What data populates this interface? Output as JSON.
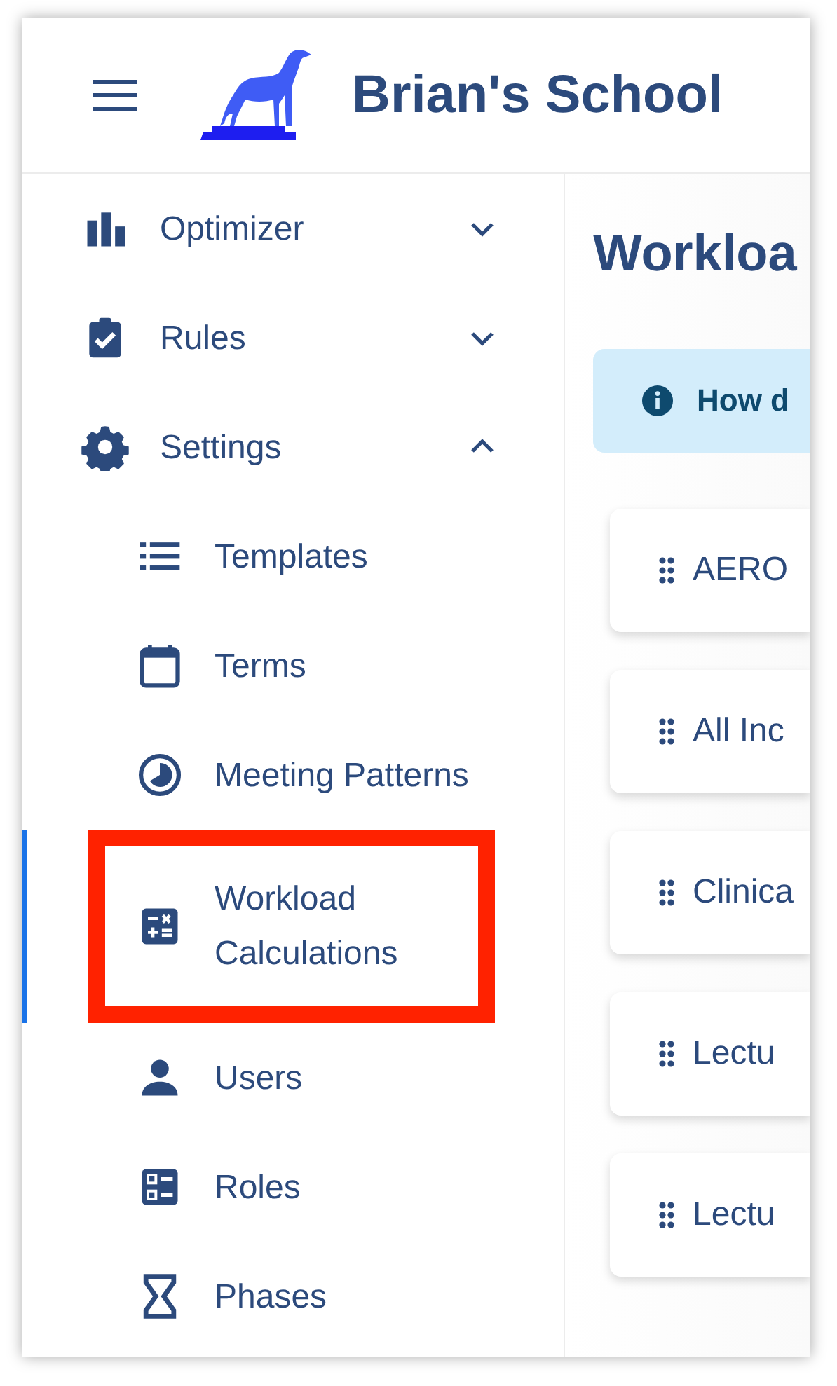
{
  "header": {
    "title": "Brian's School"
  },
  "sidebar": {
    "items": [
      {
        "label": "Optimizer",
        "kind": "chart",
        "expanded": false
      },
      {
        "label": "Rules",
        "kind": "clipboard",
        "expanded": false
      },
      {
        "label": "Settings",
        "kind": "gear",
        "expanded": true,
        "children": [
          {
            "label": "Templates",
            "kind": "list",
            "selected": false,
            "highlighted": false
          },
          {
            "label": "Terms",
            "kind": "calendar",
            "selected": false,
            "highlighted": false
          },
          {
            "label": "Meeting Patterns",
            "kind": "clock",
            "selected": false,
            "highlighted": false
          },
          {
            "label": "Workload\nCalculations",
            "kind": "calculator",
            "selected": true,
            "highlighted": true
          },
          {
            "label": "Users",
            "kind": "person",
            "selected": false,
            "highlighted": false
          },
          {
            "label": "Roles",
            "kind": "roles",
            "selected": false,
            "highlighted": false
          },
          {
            "label": "Phases",
            "kind": "hourglass",
            "selected": false,
            "highlighted": false
          }
        ]
      }
    ]
  },
  "content": {
    "title": "Workloa",
    "info": "How d",
    "cards": [
      {
        "label": "AERO"
      },
      {
        "label": "All Inc"
      },
      {
        "label": "Clinica"
      },
      {
        "label": "Lectu"
      },
      {
        "label": "Lectu"
      }
    ]
  }
}
